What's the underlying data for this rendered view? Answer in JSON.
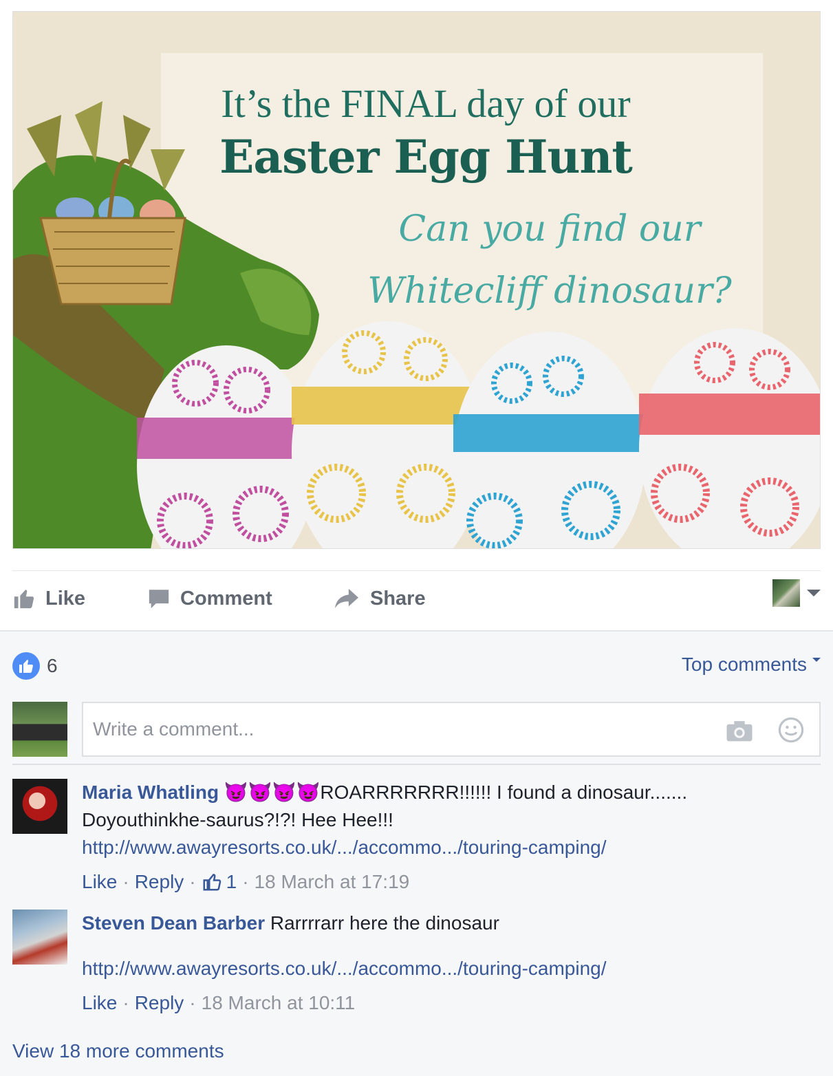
{
  "post_image": {
    "line1": "It’s the FINAL day of our",
    "line2": "Easter Egg Hunt",
    "line3": "Can you find our",
    "line4": "Whitecliff dinosaur?",
    "colors": {
      "bg": "#ece3d1",
      "card": "#f3ede1",
      "title": "#1f6e5f",
      "script": "#48aaa3",
      "egg_purple": "#c04fa0",
      "egg_yellow": "#e8c34a",
      "egg_blue": "#2fa3d2",
      "egg_red": "#e9656d",
      "dino": "#4f8a28"
    }
  },
  "actions": {
    "like": "Like",
    "comment": "Comment",
    "share": "Share"
  },
  "reactions": {
    "count": "6",
    "sort_label": "Top comments"
  },
  "composer": {
    "placeholder": "Write a comment..."
  },
  "comments": [
    {
      "author": "Maria Whatling",
      "emoji": "😈😈😈😈",
      "text_line1": "ROARRRRRRR!!!!!! I found a dinosaur.......",
      "text_line2": "Doyouthinkhe-saurus?!?! Hee Hee!!!",
      "link": "http://www.awayresorts.co.uk/.../accommo.../touring-camping/",
      "like_label": "Like",
      "reply_label": "Reply",
      "like_count": "1",
      "time": "18 March at 17:19"
    },
    {
      "author": "Steven Dean Barber",
      "text": "Rarrrrarr here the dinosaur",
      "link": "http://www.awayresorts.co.uk/.../accommo.../touring-camping/",
      "like_label": "Like",
      "reply_label": "Reply",
      "time": "18 March at 10:11"
    }
  ],
  "view_more": "View 18 more comments",
  "colors": {
    "link": "#385898",
    "muted": "#90949c",
    "action": "#606770",
    "like_blue": "#4f8cf6"
  }
}
